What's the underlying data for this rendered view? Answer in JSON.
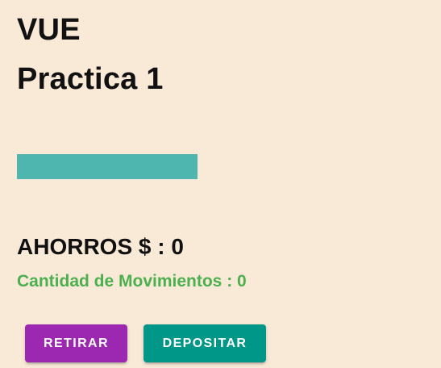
{
  "header": {
    "title": "VUE",
    "subtitle": "Practica 1"
  },
  "colors": {
    "background": "#f9ead8",
    "bar": "#4fb6af",
    "count_text": "#4caf50",
    "retirar_button": "#9c27b0",
    "depositar_button": "#009688"
  },
  "savings": {
    "text": "AHORROS $ : 0"
  },
  "movements": {
    "text": "Cantidad de Movimientos : 0"
  },
  "actions": {
    "retirar_label": "RETIRAR",
    "depositar_label": "DEPOSITAR"
  }
}
